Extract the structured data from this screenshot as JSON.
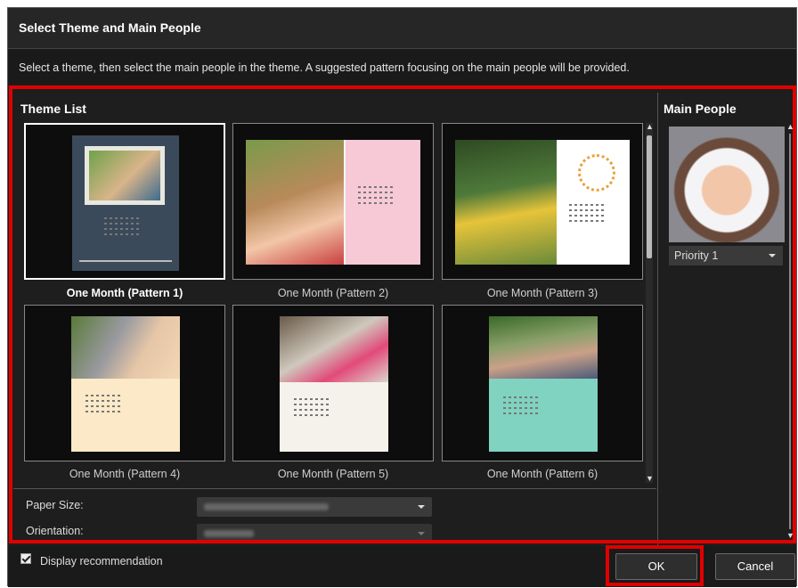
{
  "dialog": {
    "title": "Select Theme and Main People",
    "instruction": "Select a theme, then select the main people in the theme. A suggested pattern focusing on the main people will be provided."
  },
  "theme_list": {
    "header": "Theme List",
    "items": [
      {
        "label": "One Month (Pattern 1)",
        "selected": true
      },
      {
        "label": "One Month (Pattern 2)",
        "selected": false
      },
      {
        "label": "One Month (Pattern 3)",
        "selected": false
      },
      {
        "label": "One Month (Pattern 4)",
        "selected": false
      },
      {
        "label": "One Month (Pattern 5)",
        "selected": false
      },
      {
        "label": "One Month (Pattern 6)",
        "selected": false
      }
    ]
  },
  "settings": {
    "paper_size_label": "Paper Size:",
    "orientation_label": "Orientation:"
  },
  "main_people": {
    "header": "Main People",
    "priority_value": "Priority 1"
  },
  "footer": {
    "display_recommendation_label": "Display recommendation",
    "display_recommendation_checked": true,
    "ok_label": "OK",
    "cancel_label": "Cancel"
  },
  "colors": {
    "highlight": "#e00000",
    "background": "#1d1d1d"
  }
}
